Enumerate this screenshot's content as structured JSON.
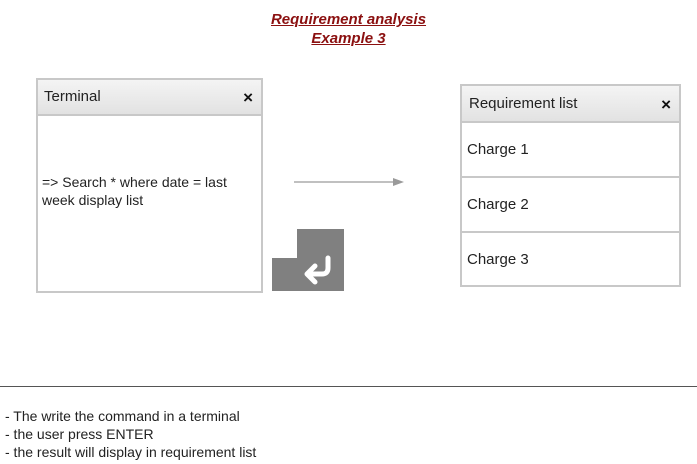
{
  "header": {
    "title_line1": "Requirement analysis",
    "title_line2": "Example 3"
  },
  "terminal": {
    "title": "Terminal",
    "close": "×",
    "command": "=> Search * where date = last week display list"
  },
  "requirement_list": {
    "title": "Requirement list",
    "close": "×",
    "items": [
      {
        "label": "Charge 1"
      },
      {
        "label": "Charge 2"
      },
      {
        "label": "Charge 3"
      }
    ]
  },
  "icons": {
    "arrow": "arrow-right-icon",
    "enter": "enter-key-icon"
  },
  "notes": [
    "- The write the command in a terminal",
    "- the user press ENTER",
    "- the result will display in requirement list"
  ],
  "colors": {
    "title": "#8b1010",
    "border": "#c8c8c8",
    "enter_key": "#808080"
  }
}
